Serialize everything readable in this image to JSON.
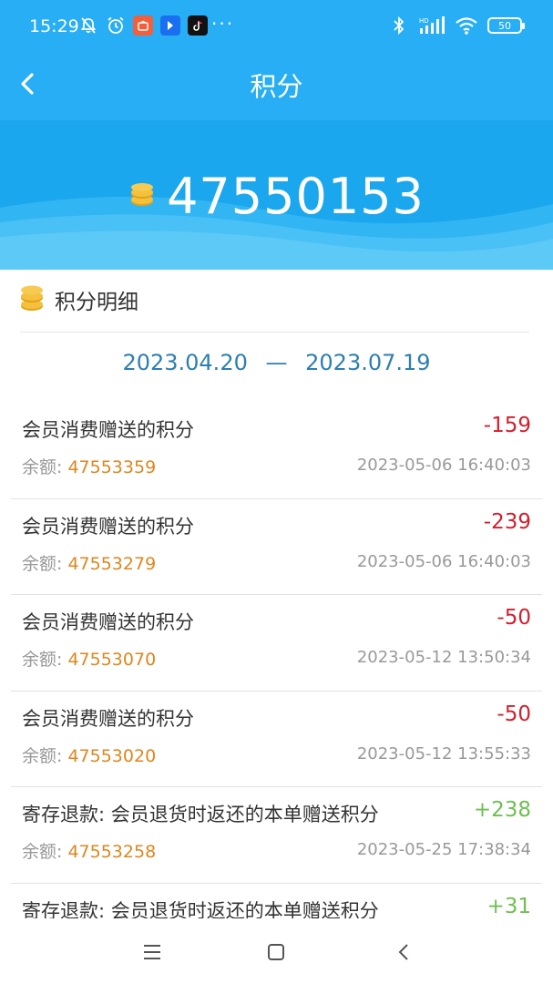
{
  "status_bar": {
    "time": "15:29",
    "left_icons": [
      "bell-off-icon",
      "alarm-icon",
      "app-taobao-icon",
      "app-blue-icon",
      "app-tiktok-icon"
    ],
    "more": "···",
    "hd_label": "HD",
    "battery": "50"
  },
  "header": {
    "title": "积分"
  },
  "points": {
    "total": "47550153"
  },
  "section": {
    "title": "积分明细",
    "date_start": "2023.04.20",
    "date_sep": "—",
    "date_end": "2023.07.19"
  },
  "labels": {
    "balance_label": "余额: "
  },
  "items": [
    {
      "title": "会员消费赠送的积分",
      "amount": "-159",
      "balance": "47553359",
      "time": "2023-05-06 16:40:03",
      "type": "neg"
    },
    {
      "title": "会员消费赠送的积分",
      "amount": "-239",
      "balance": "47553279",
      "time": "2023-05-06 16:40:03",
      "type": "neg"
    },
    {
      "title": "会员消费赠送的积分",
      "amount": "-50",
      "balance": "47553070",
      "time": "2023-05-12 13:50:34",
      "type": "neg"
    },
    {
      "title": "会员消费赠送的积分",
      "amount": "-50",
      "balance": "47553020",
      "time": "2023-05-12 13:55:33",
      "type": "neg"
    },
    {
      "title": "寄存退款: 会员退货时返还的本单赠送积分",
      "amount": "+238",
      "balance": "47553258",
      "time": "2023-05-25 17:38:34",
      "type": "pos"
    },
    {
      "title": "寄存退款: 会员退货时返还的本单赠送积分",
      "amount": "+31",
      "balance": "",
      "time": "",
      "type": "pos"
    }
  ],
  "colors": {
    "header_bg": "#27aef5",
    "negative": "#d11f2f",
    "positive": "#6fbf52",
    "balance_value": "#e0861c",
    "date_range": "#2d7fb0"
  }
}
